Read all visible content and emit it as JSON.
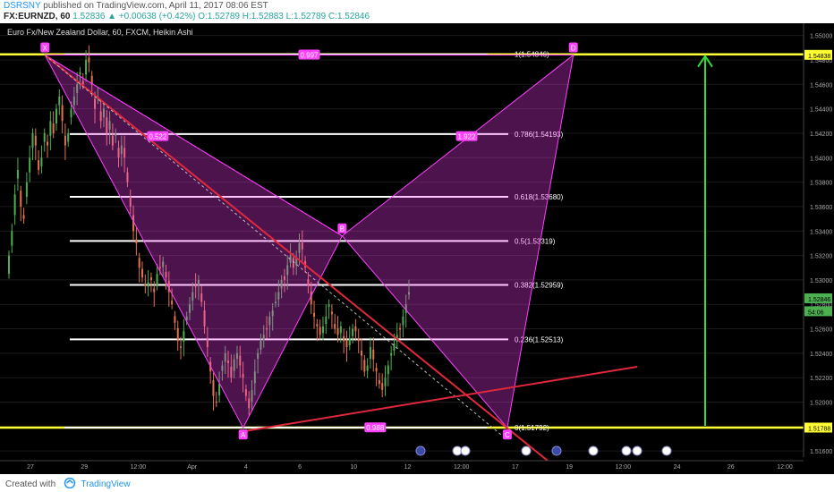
{
  "header": {
    "author": "DSRSNY",
    "published": "published on TradingView.com, April 11, 2017 08:06 EST",
    "symbol": "FX:EURNZD, 60",
    "ohlc": "1.52836 ▲ +0.00638 (+0.42%) O:1.52789 H:1.52883 L:1.52789 C:1.52846"
  },
  "chart": {
    "title": "Euro Fx/New Zealand Dollar, 60, FXCM, Heikin Ashi"
  },
  "footer": {
    "created_with": "Created with",
    "brand": "TradingView"
  },
  "colors": {
    "background": "#000000",
    "bull": "#4caf50",
    "bear": "#e57350",
    "pattern": "#ff40ff",
    "fib": "#ffffff",
    "extreme_line": "#ffff33",
    "trendline": "#e0283c",
    "target_arrow": "#33dd33"
  },
  "chart_data": {
    "type": "candlestick",
    "title": "Euro Fx/New Zealand Dollar, 60, FXCM, Heikin Ashi",
    "y_range": [
      1.5155,
      1.551
    ],
    "x_tick_labels": [
      "27",
      "29",
      "12:00",
      "Apr",
      "4",
      "6",
      "10",
      "12",
      "12:00",
      "17",
      "19",
      "12:00",
      "24",
      "26",
      "12:00"
    ],
    "price_axis_labels": [
      "1.55000",
      "1.54800",
      "1.54600",
      "1.54400",
      "1.54200",
      "1.54000",
      "1.53800",
      "1.53600",
      "1.53400",
      "1.53200",
      "1.53000",
      "1.52800",
      "1.52600",
      "1.52400",
      "1.52200",
      "1.52000",
      "1.51800",
      "1.51600"
    ],
    "price_tags": [
      {
        "label": "1.54838",
        "value": 1.54838,
        "color": "#ffff33"
      },
      {
        "label": "1.52846",
        "value": 1.52846,
        "color": "#4caf50"
      },
      {
        "label": "54:06",
        "value": 1.5274,
        "color": "#4caf50"
      },
      {
        "label": "1.51788",
        "value": 1.51788,
        "color": "#ffff33"
      }
    ],
    "fib_levels": [
      {
        "label": "1(1.54846)",
        "value": 1.54846
      },
      {
        "label": "0.786(1.54193)",
        "value": 1.54193
      },
      {
        "label": "0.618(1.53680)",
        "value": 1.5368
      },
      {
        "label": "0.5(1.53319)",
        "value": 1.53319
      },
      {
        "label": "0.382(1.52959)",
        "value": 1.52959
      },
      {
        "label": "0.236(1.52513)",
        "value": 1.52513
      },
      {
        "label": "0(1.51792)",
        "value": 1.51792
      }
    ],
    "pattern_points": [
      {
        "label": "X",
        "x": "Mar 28",
        "y": 1.5484
      },
      {
        "label": "A",
        "x": "Apr 3",
        "y": 1.5179
      },
      {
        "label": "B",
        "x": "Apr 6",
        "y": 1.5336
      },
      {
        "label": "C",
        "x": "Apr 11",
        "y": 1.5179
      },
      {
        "label": "D",
        "x": "Apr 13",
        "y": 1.5484
      }
    ],
    "ratio_labels": [
      "0.522",
      "1.922",
      "0.997",
      "0.988"
    ],
    "series": [
      {
        "name": "EURNZD",
        "values": [
          1.532,
          1.534,
          1.537,
          1.539,
          1.536,
          1.535,
          1.538,
          1.54,
          1.542,
          1.541,
          1.539,
          1.54,
          1.542,
          1.541,
          1.543,
          1.542,
          1.544,
          1.545,
          1.543,
          1.541,
          1.542,
          1.544,
          1.545,
          1.546,
          1.547,
          1.546,
          1.548,
          1.5478,
          1.546,
          1.544,
          1.545,
          1.543,
          1.544,
          1.542,
          1.543,
          1.541,
          1.542,
          1.54,
          1.541,
          1.54,
          1.538,
          1.536,
          1.534,
          1.533,
          1.531,
          1.5302,
          1.5295,
          1.5298,
          1.53,
          1.529,
          1.5305,
          1.531,
          1.5315,
          1.5302,
          1.529,
          1.528,
          1.5265,
          1.525,
          1.5245,
          1.5258,
          1.527,
          1.528,
          1.529,
          1.5295,
          1.53,
          1.5282,
          1.5262,
          1.5245,
          1.5225,
          1.5205,
          1.52,
          1.5215,
          1.523,
          1.524,
          1.5232,
          1.522,
          1.5235,
          1.524,
          1.523,
          1.522,
          1.5205,
          1.5195,
          1.521,
          1.5225,
          1.524,
          1.525,
          1.5255,
          1.526,
          1.527,
          1.5275,
          1.5282,
          1.529,
          1.53,
          1.53,
          1.5312,
          1.532,
          1.531,
          1.5318,
          1.533,
          1.5325,
          1.531,
          1.5295,
          1.528,
          1.527,
          1.5262,
          1.5255,
          1.5262,
          1.527,
          1.528,
          1.5272,
          1.526,
          1.5255,
          1.5262,
          1.525,
          1.5245,
          1.5252,
          1.526,
          1.5258,
          1.525,
          1.5238,
          1.5225,
          1.523,
          1.5245,
          1.5235,
          1.5225,
          1.5215,
          1.521,
          1.522,
          1.523,
          1.524,
          1.5248,
          1.5255,
          1.526,
          1.527,
          1.528,
          1.529
        ]
      }
    ]
  }
}
